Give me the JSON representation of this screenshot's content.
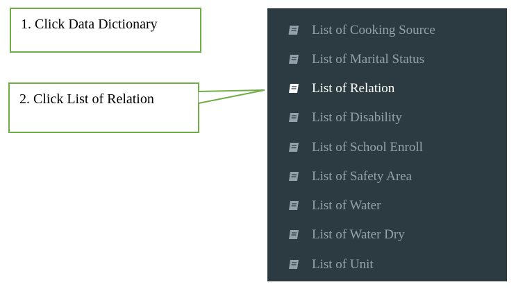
{
  "callouts": {
    "step1": "1. Click Data Dictionary",
    "step2": "2. Click List of Relation"
  },
  "sidebar": {
    "items": [
      {
        "label": "List of Cooking Source",
        "icon": "book-icon",
        "active": false
      },
      {
        "label": "List of Marital Status",
        "icon": "book-icon",
        "active": false
      },
      {
        "label": "List of Relation",
        "icon": "book-icon",
        "active": true
      },
      {
        "label": "List of Disability",
        "icon": "book-icon",
        "active": false
      },
      {
        "label": "List of School Enroll",
        "icon": "book-icon",
        "active": false
      },
      {
        "label": "List of Safety Area",
        "icon": "book-icon",
        "active": false
      },
      {
        "label": "List of Water",
        "icon": "book-icon",
        "active": false
      },
      {
        "label": "List of Water Dry",
        "icon": "book-icon",
        "active": false
      },
      {
        "label": "List of Unit",
        "icon": "book-icon",
        "active": false
      }
    ]
  },
  "colors": {
    "sidebar_bg": "#2c3a42",
    "item_text": "#93a2aa",
    "active_text": "#ffffff",
    "callout_border": "#70ad47"
  }
}
